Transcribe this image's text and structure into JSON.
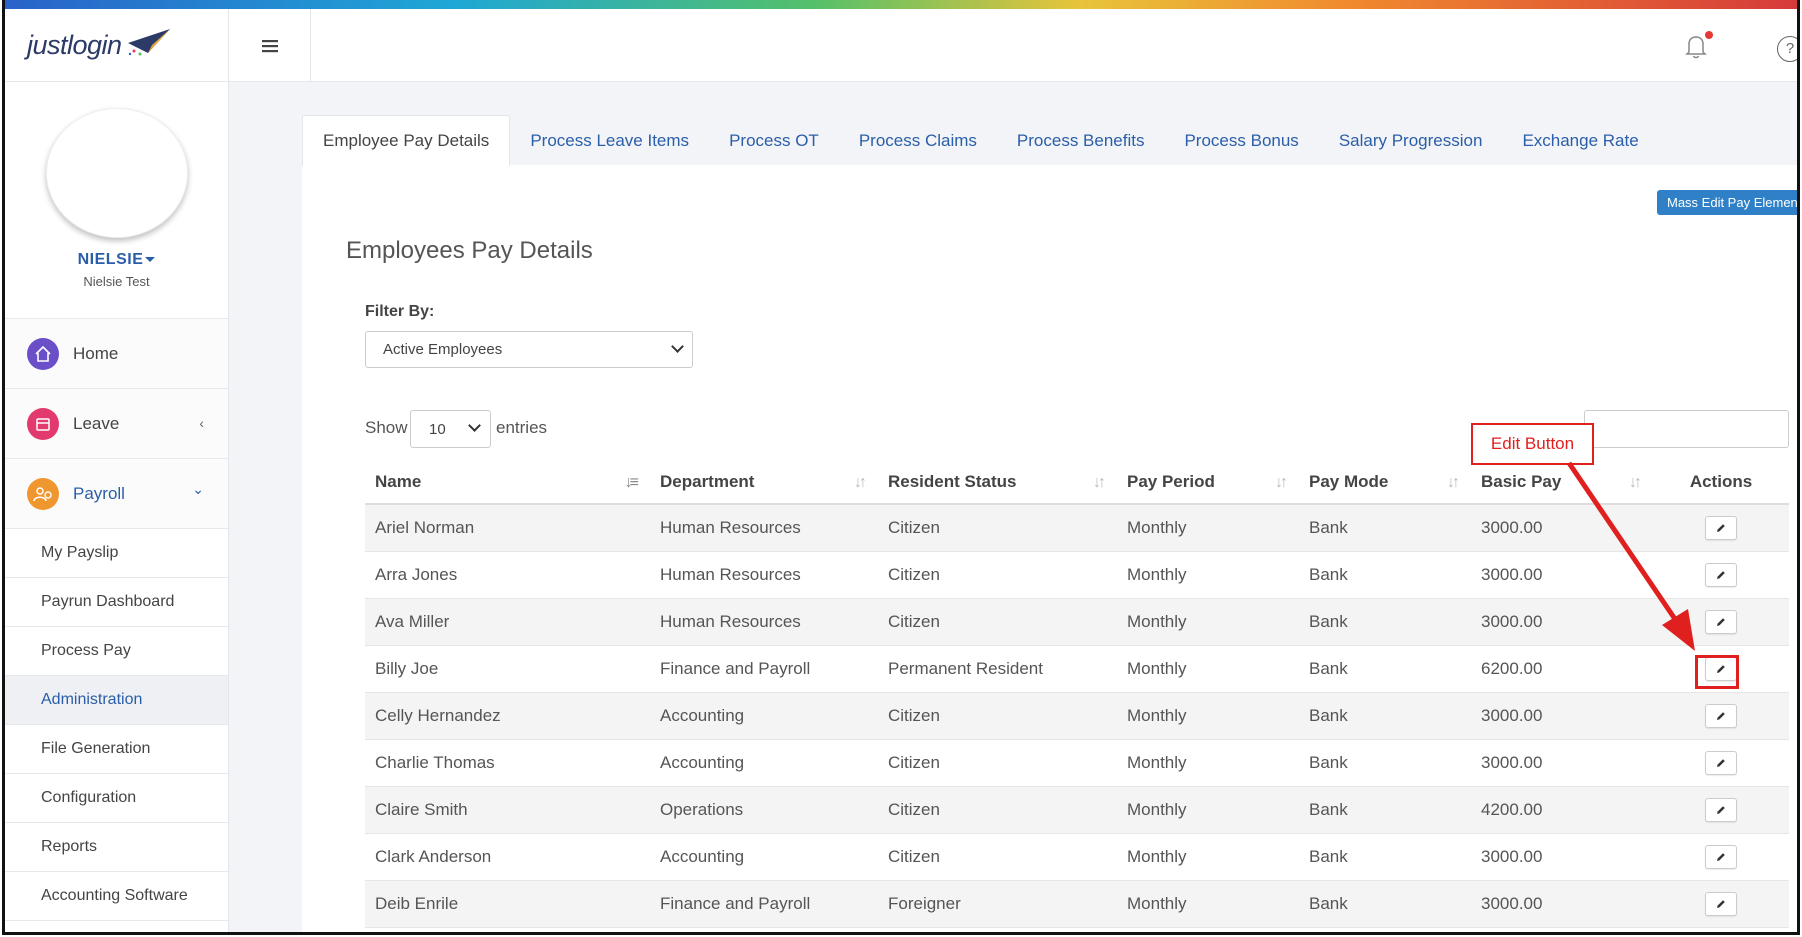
{
  "brand": {
    "logo_text": "justlogin"
  },
  "profile": {
    "username": "NIELSIE",
    "fullname": "Nielsie Test"
  },
  "sidebar": {
    "main": [
      {
        "label": "Home",
        "color": "#6a4fc9"
      },
      {
        "label": "Leave",
        "color": "#e23a6e",
        "chevron": "‹"
      },
      {
        "label": "Payroll",
        "color": "#f0962e",
        "chevron": "⌄"
      }
    ],
    "sub_items": [
      {
        "label": "My Payslip"
      },
      {
        "label": "Payrun Dashboard"
      },
      {
        "label": "Process Pay"
      },
      {
        "label": "Administration"
      },
      {
        "label": "File Generation"
      },
      {
        "label": "Configuration"
      },
      {
        "label": "Reports"
      },
      {
        "label": "Accounting Software"
      }
    ]
  },
  "topbar": {
    "help_glyph": "?"
  },
  "tabs": [
    {
      "label": "Employee Pay Details"
    },
    {
      "label": "Process Leave Items"
    },
    {
      "label": "Process OT"
    },
    {
      "label": "Process Claims"
    },
    {
      "label": "Process Benefits"
    },
    {
      "label": "Process Bonus"
    },
    {
      "label": "Salary Progression"
    },
    {
      "label": "Exchange Rate"
    }
  ],
  "mass_edit_label": "Mass Edit Pay Elements",
  "page_title": "Employees Pay Details",
  "filter": {
    "label": "Filter By:",
    "value": "Active Employees"
  },
  "show": {
    "label": "Show",
    "value": "10",
    "suffix": "entries"
  },
  "search": {
    "placeholder": ""
  },
  "table": {
    "headers": [
      "Name",
      "Department",
      "Resident Status",
      "Pay Period",
      "Pay Mode",
      "Basic Pay",
      "Actions"
    ],
    "rows": [
      [
        "Ariel Norman",
        "Human Resources",
        "Citizen",
        "Monthly",
        "Bank",
        "3000.00"
      ],
      [
        "Arra Jones",
        "Human Resources",
        "Citizen",
        "Monthly",
        "Bank",
        "3000.00"
      ],
      [
        "Ava Miller",
        "Human Resources",
        "Citizen",
        "Monthly",
        "Bank",
        "3000.00"
      ],
      [
        "Billy Joe",
        "Finance and Payroll",
        "Permanent Resident",
        "Monthly",
        "Bank",
        "6200.00"
      ],
      [
        "Celly Hernandez",
        "Accounting",
        "Citizen",
        "Monthly",
        "Bank",
        "3000.00"
      ],
      [
        "Charlie Thomas",
        "Accounting",
        "Citizen",
        "Monthly",
        "Bank",
        "3000.00"
      ],
      [
        "Claire Smith",
        "Operations",
        "Citizen",
        "Monthly",
        "Bank",
        "4200.00"
      ],
      [
        "Clark Anderson",
        "Accounting",
        "Citizen",
        "Monthly",
        "Bank",
        "3000.00"
      ],
      [
        "Deib Enrile",
        "Finance and Payroll",
        "Foreigner",
        "Monthly",
        "Bank",
        "3000.00"
      ]
    ]
  },
  "annotation": {
    "label": "Edit Button",
    "color": "#e0201f"
  }
}
